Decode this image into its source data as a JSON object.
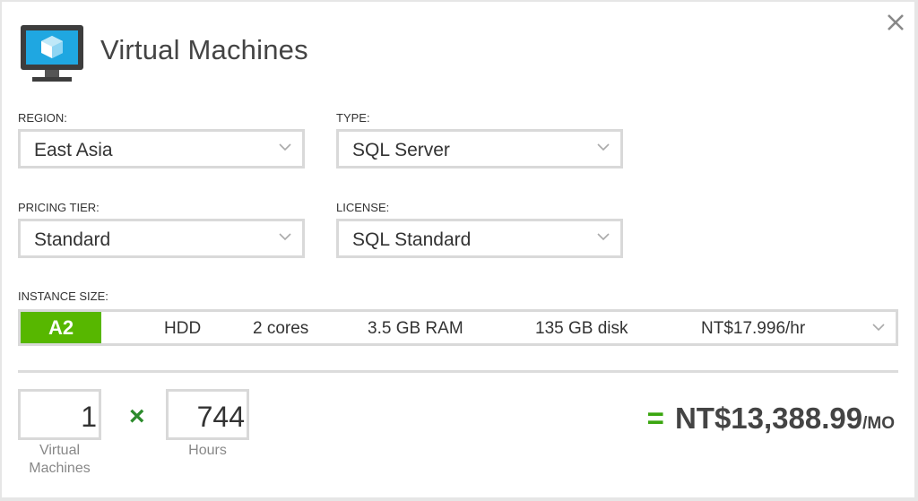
{
  "header": {
    "title": "Virtual Machines",
    "icon": "virtual-machine-icon"
  },
  "region": {
    "label": "REGION:",
    "value": "East Asia"
  },
  "type": {
    "label": "TYPE:",
    "value": "SQL Server"
  },
  "pricing_tier": {
    "label": "PRICING TIER:",
    "value": "Standard"
  },
  "license": {
    "label": "LICENSE:",
    "value": "SQL Standard"
  },
  "instance_size": {
    "label": "INSTANCE SIZE:",
    "name": "A2",
    "disk_type": "HDD",
    "cores": "2 cores",
    "ram": "3.5 GB RAM",
    "disk": "135 GB disk",
    "price": "NT$17.996/hr"
  },
  "calculator": {
    "vm_count": "1",
    "vm_label_line1": "Virtual",
    "vm_label_line2": "Machines",
    "multiply": "×",
    "hours": "744",
    "hours_label": "Hours",
    "equals": "=",
    "total": "NT$13,388.99",
    "period": "/MO"
  },
  "colors": {
    "accent_green": "#57b700",
    "times_green": "#2c8b2c",
    "icon_blue": "#1fa7e1"
  }
}
